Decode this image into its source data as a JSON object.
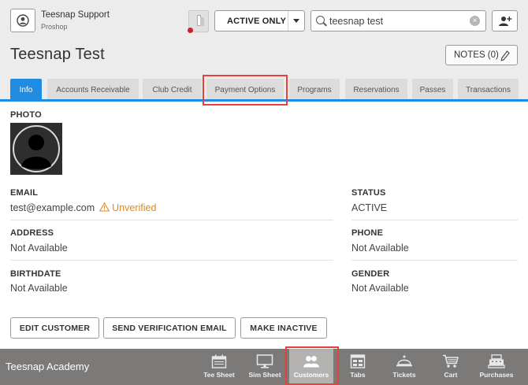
{
  "header": {
    "user_name": "Teesnap Support",
    "user_role": "Proshop",
    "filter_value": "ACTIVE ONLY",
    "search_value": "teesnap test"
  },
  "page": {
    "title": "Teesnap Test",
    "notes_label": "NOTES (0)"
  },
  "tabs": [
    {
      "label": "Info",
      "active": true
    },
    {
      "label": "Accounts Receivable"
    },
    {
      "label": "Club Credit"
    },
    {
      "label": "Payment Options",
      "highlighted": true
    },
    {
      "label": "Programs"
    },
    {
      "label": "Reservations"
    },
    {
      "label": "Passes"
    },
    {
      "label": "Transactions"
    }
  ],
  "info": {
    "photo_label": "PHOTO",
    "email_label": "EMAIL",
    "email_value": "test@example.com",
    "email_status": "Unverified",
    "status_label": "STATUS",
    "status_value": "ACTIVE",
    "address_label": "ADDRESS",
    "address_value": "Not Available",
    "phone_label": "PHONE",
    "phone_value": "Not Available",
    "birthdate_label": "BIRTHDATE",
    "birthdate_value": "Not Available",
    "gender_label": "GENDER",
    "gender_value": "Not Available"
  },
  "actions": {
    "edit": "EDIT CUSTOMER",
    "verify": "SEND VERIFICATION EMAIL",
    "inactive": "MAKE INACTIVE"
  },
  "footer": {
    "academy": "Teesnap Academy",
    "nav": [
      {
        "label": "Tee Sheet",
        "icon": "calendar-icon"
      },
      {
        "label": "Sim Sheet",
        "icon": "monitor-icon"
      },
      {
        "label": "Customers",
        "icon": "users-icon",
        "active": true
      },
      {
        "label": "Tabs",
        "icon": "tabs-icon"
      },
      {
        "label": "Tickets",
        "icon": "cloche-icon"
      },
      {
        "label": "Cart",
        "icon": "cart-icon"
      },
      {
        "label": "Purchases",
        "icon": "register-icon"
      }
    ]
  },
  "colors": {
    "accent": "#1f8ce0",
    "highlight": "#e8403a",
    "warning": "#e08a1e",
    "footer_bg": "#7b7a79"
  }
}
